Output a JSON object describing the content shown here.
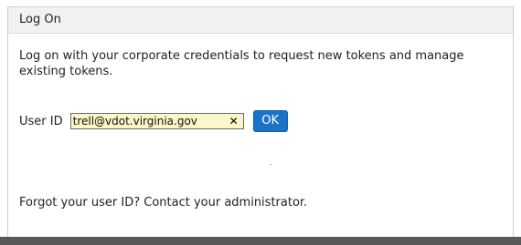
{
  "panel": {
    "title": "Log On"
  },
  "intro": {
    "text": "Log on with your corporate credentials to request new tokens and manage existing tokens."
  },
  "user_id": {
    "label": "User ID",
    "value": "trell@vdot.virginia.gov",
    "clear_icon": "close-icon"
  },
  "ok_button": {
    "label": "OK"
  },
  "help": {
    "text": "Forgot your user ID? Contact your administrator."
  },
  "colors": {
    "input_background": "#fbf7c8",
    "button": "#1b73c8",
    "header_background": "#f2f2f2",
    "bottom_bar": "#595959"
  }
}
